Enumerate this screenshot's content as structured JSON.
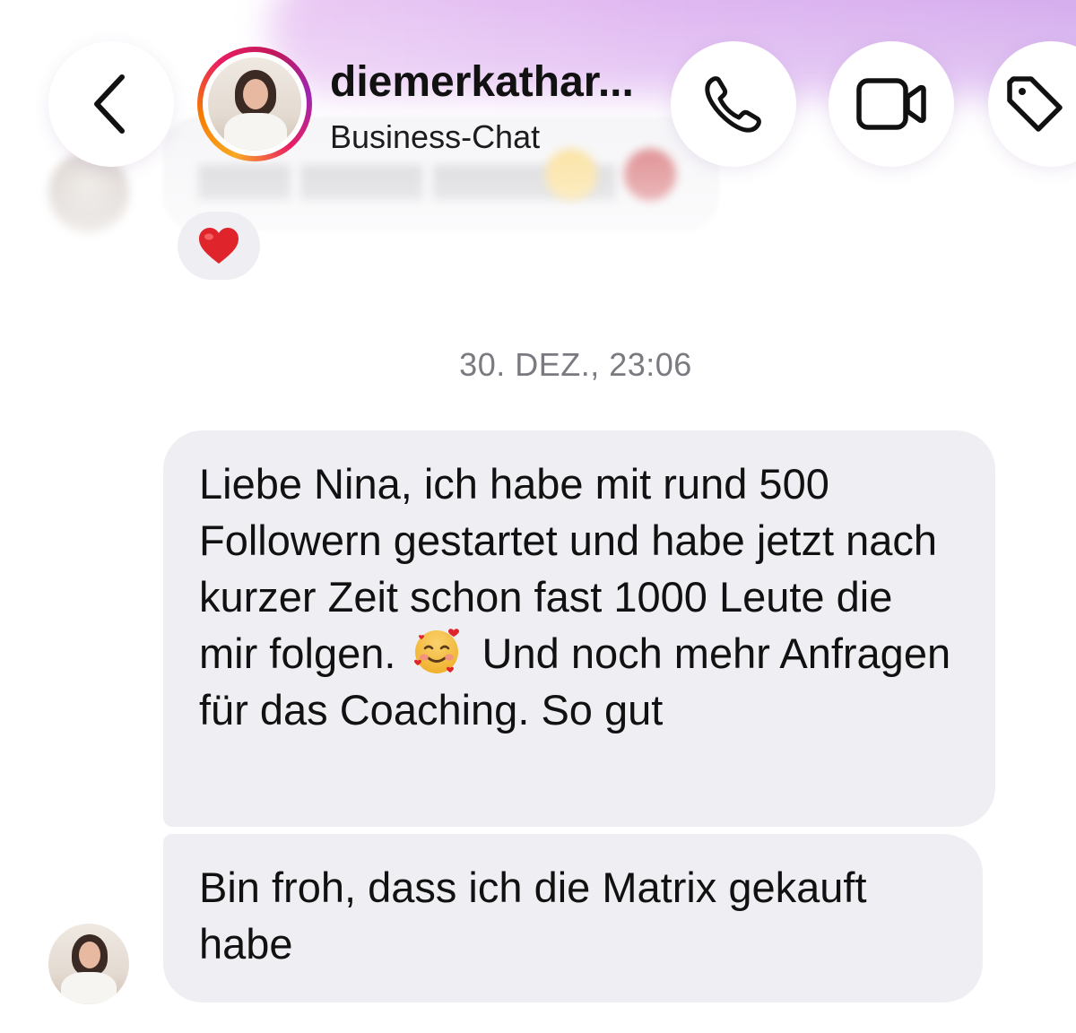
{
  "header": {
    "contact_name": "diemerkathar...",
    "subtitle": "Business-Chat",
    "icons": {
      "back": "chevron-left-icon",
      "call": "phone-icon",
      "video": "video-camera-icon",
      "tag": "tag-icon"
    }
  },
  "previous_message": {
    "reaction": "❤️"
  },
  "timestamp": "30. DEZ., 23:06",
  "messages": [
    {
      "text_before_emoji": "Liebe Nina, ich habe mit rund 500 Followern gestartet und habe jetzt nach kurzer Zeit schon fast 1000 Leute die mir folgen.",
      "emoji": "smiling-face-with-hearts",
      "text_after_emoji": "Und noch mehr Anfragen für das Coaching. So gut"
    },
    {
      "text": "Bin froh, dass ich die Matrix gekauft habe"
    }
  ],
  "colors": {
    "bubble": "#efeff3",
    "header_glow": "#dcb0f0",
    "timestamp": "#7a7a80",
    "story_ring_start": "#f9a825",
    "story_ring_end": "#9c27b0"
  }
}
